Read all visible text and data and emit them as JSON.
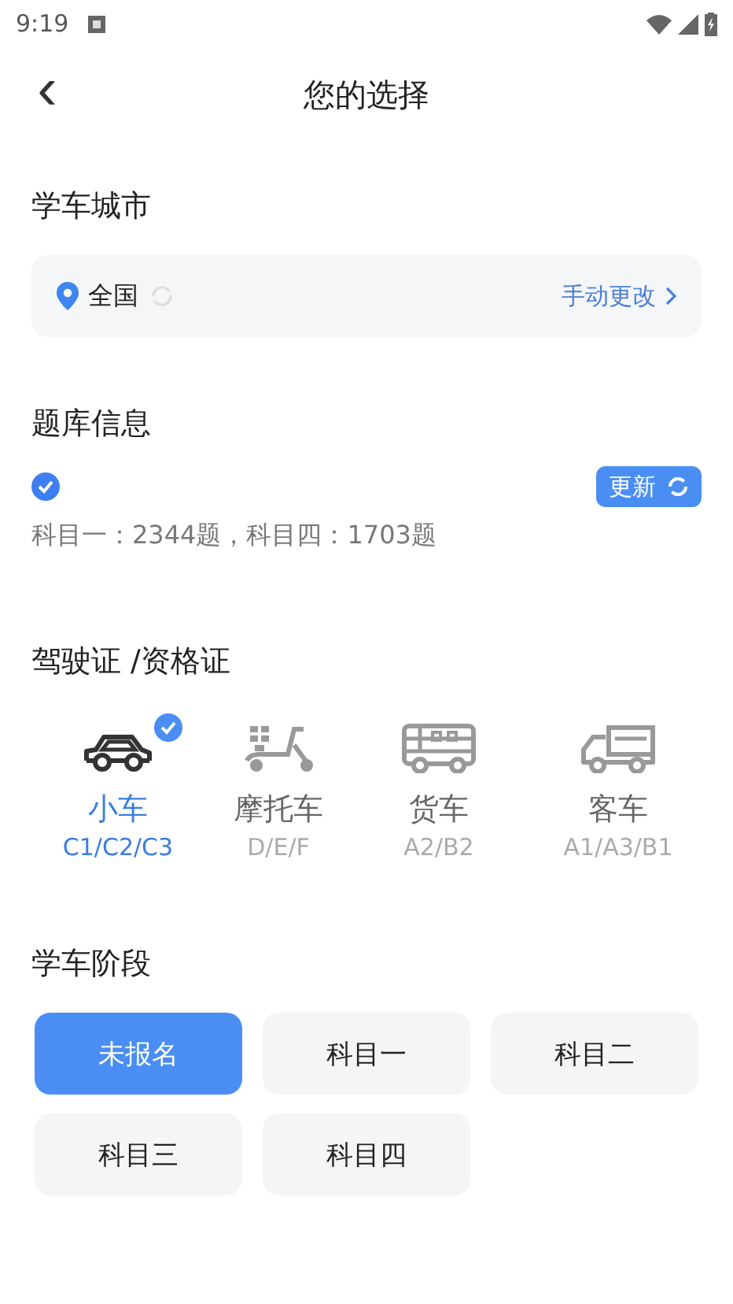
{
  "status_bar": {
    "time": "9:19"
  },
  "header": {
    "back": "‹",
    "title": "您的选择"
  },
  "city": {
    "title": "学车城市",
    "value": "全国",
    "action": "手动更改"
  },
  "bank": {
    "title": "题库信息",
    "synced": true,
    "update_button": "更新",
    "stats": "科目一：2344题，科目四：1703题"
  },
  "license": {
    "title": "驾驶证 /资格证",
    "vehicles": [
      {
        "kind": "car",
        "name": "小车",
        "codes": "C1/C2/C3",
        "selected": true
      },
      {
        "kind": "scooter",
        "name": "摩托车",
        "codes": "D/E/F",
        "selected": false
      },
      {
        "kind": "bus",
        "name": "货车",
        "codes": "A2/B2",
        "selected": false
      },
      {
        "kind": "truck",
        "name": "客车",
        "codes": "A1/A3/B1",
        "selected": false
      }
    ]
  },
  "stage": {
    "title": "学车阶段",
    "options": [
      {
        "label": "未报名",
        "selected": true
      },
      {
        "label": "科目一",
        "selected": false
      },
      {
        "label": "科目二",
        "selected": false
      },
      {
        "label": "科目三",
        "selected": false
      },
      {
        "label": "科目四",
        "selected": false
      }
    ]
  }
}
